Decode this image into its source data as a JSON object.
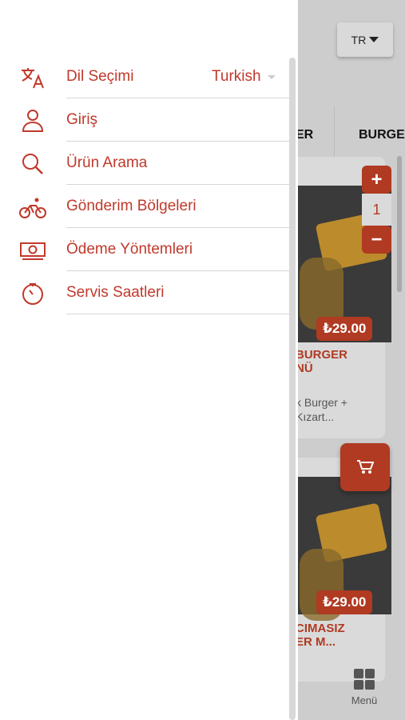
{
  "app": {
    "language_button": "TR",
    "categories": [
      "ER",
      "BURGE"
    ],
    "products": [
      {
        "price": "₺29.00",
        "title_line1": "BURGER",
        "title_line2": "NÜ",
        "desc_line1": "k Burger +",
        "desc_line2": "Kızart..."
      },
      {
        "price": "₺29.00",
        "title_line1": "CIMASIZ",
        "title_line2": "ER M...",
        "desc_line1": "",
        "desc_line2": ""
      }
    ],
    "stepper": {
      "plus": "+",
      "value": "1",
      "minus": "−"
    },
    "bottom_nav": {
      "menu_label": "Menü"
    }
  },
  "drawer": {
    "items": [
      {
        "label": "Dil Seçimi",
        "icon": "translate-icon",
        "value": "Turkish"
      },
      {
        "label": "Giriş",
        "icon": "user-icon"
      },
      {
        "label": "Ürün Arama",
        "icon": "search-icon"
      },
      {
        "label": "Gönderim Bölgeleri",
        "icon": "bicycle-icon"
      },
      {
        "label": "Ödeme Yöntemleri",
        "icon": "money-icon"
      },
      {
        "label": "Servis Saatleri",
        "icon": "timer-icon"
      }
    ]
  },
  "colors": {
    "accent": "#c0392b",
    "price_bg": "#b03a22",
    "overlay_bg": "#cdcdcd"
  }
}
